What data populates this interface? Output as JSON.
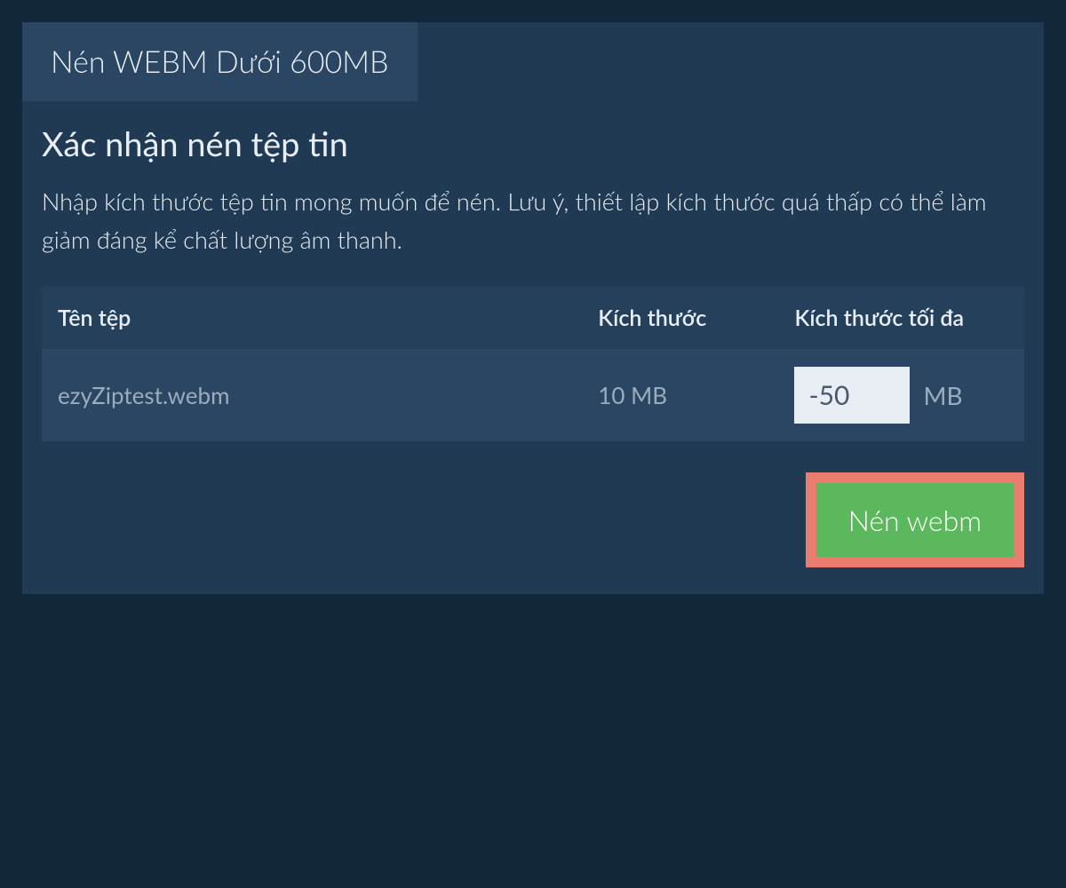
{
  "tab": {
    "label": "Nén WEBM Dưới 600MB"
  },
  "content": {
    "title": "Xác nhận nén tệp tin",
    "description": "Nhập kích thước tệp tin mong muốn để nén. Lưu ý, thiết lập kích thước quá thấp có thể làm giảm đáng kể chất lượng âm thanh."
  },
  "table": {
    "headers": {
      "filename": "Tên tệp",
      "size": "Kích thước",
      "maxsize": "Kích thước tối đa"
    },
    "row": {
      "filename": "ezyZiptest.webm",
      "size": "10 MB",
      "maxsize_value": "-50",
      "maxsize_unit": "MB"
    }
  },
  "button": {
    "compress_label": "Nén webm"
  }
}
